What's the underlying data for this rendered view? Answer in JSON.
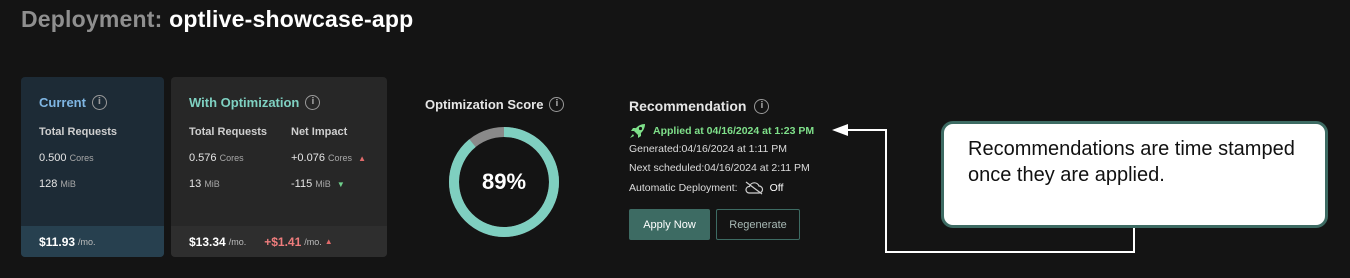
{
  "header": {
    "label": "Deployment:",
    "app_name": "optlive-showcase-app"
  },
  "current": {
    "title": "Current",
    "col_header": "Total Requests",
    "cpu_value": "0.500",
    "cpu_unit": "Cores",
    "mem_value": "128",
    "mem_unit": "MiB",
    "cost": "$11.93",
    "cost_unit": "/mo."
  },
  "optimization": {
    "title": "With Optimization",
    "col_header_requests": "Total Requests",
    "col_header_impact": "Net Impact",
    "cpu_value": "0.576",
    "cpu_unit": "Cores",
    "mem_value": "13",
    "mem_unit": "MiB",
    "cpu_impact": "+0.076",
    "cpu_impact_unit": "Cores",
    "mem_impact": "-115",
    "mem_impact_unit": "MiB",
    "cost": "$13.34",
    "cost_unit": "/mo.",
    "cost_impact": "+$1.41",
    "cost_impact_unit": "/mo."
  },
  "score": {
    "title": "Optimization Score",
    "value_label": "89%",
    "value": 0.89,
    "color_fill": "#7fcfc0",
    "color_track": "#8a8a8a"
  },
  "recommendation": {
    "title": "Recommendation",
    "applied": "Applied at 04/16/2024 at 1:23 PM",
    "generated": "Generated:04/16/2024 at 1:11 PM",
    "next_scheduled": "Next scheduled:04/16/2024 at 2:11 PM",
    "auto_label": "Automatic Deployment:",
    "auto_value": "Off",
    "apply_button": "Apply Now",
    "regenerate_button": "Regenerate"
  },
  "callout": {
    "text": "Recommendations are time stamped once they are applied."
  },
  "icons": {
    "info": "info-icon",
    "rocket": "rocket-icon",
    "cloud_off": "cloud-off-icon",
    "arrow_up": "caret-up-icon",
    "arrow_down": "caret-down-icon"
  },
  "colors": {
    "accent": "#3d6b63",
    "applied_green": "#7fe08a",
    "impact_red": "#ef7d7d"
  }
}
